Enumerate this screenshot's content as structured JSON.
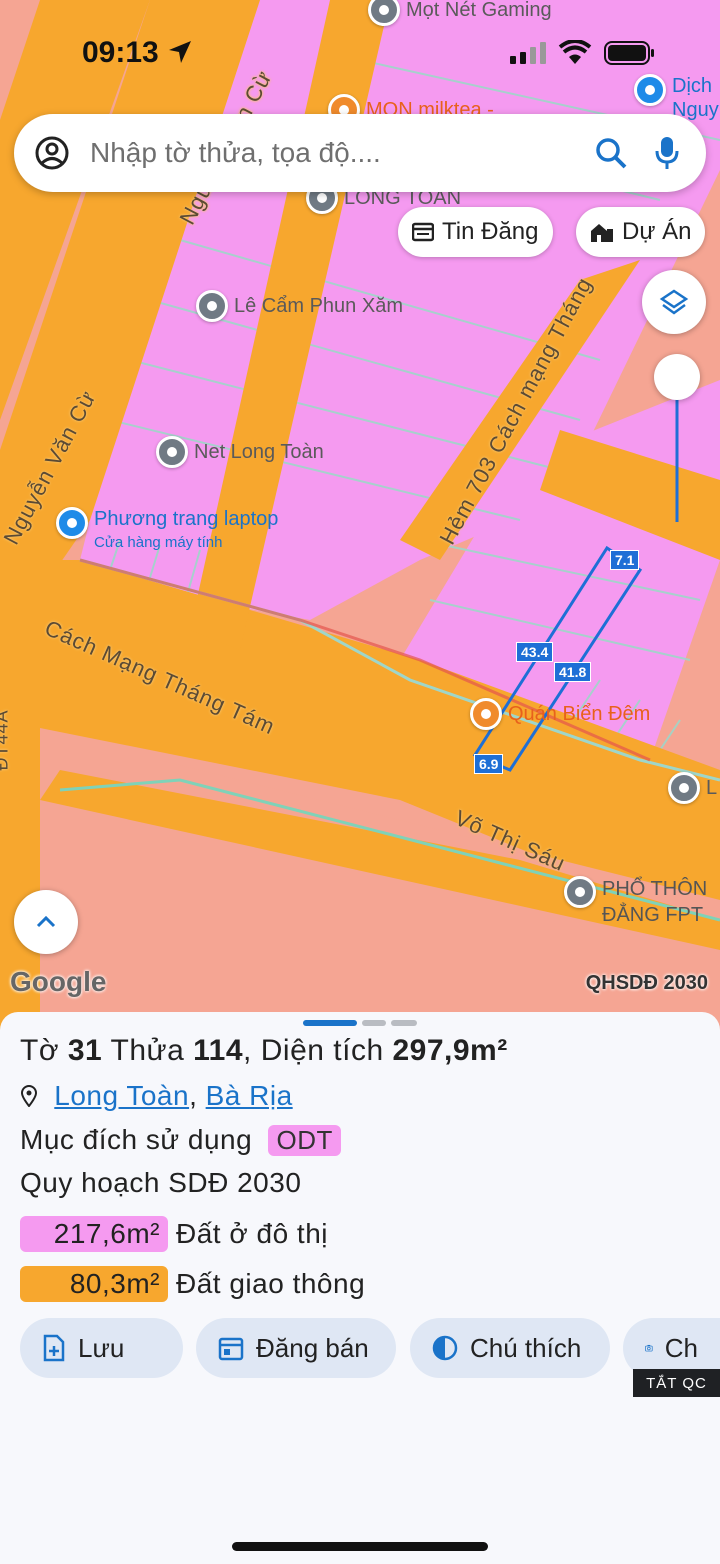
{
  "status_bar": {
    "time": "09:13"
  },
  "search": {
    "placeholder": "Nhập tờ thửa, tọa độ...."
  },
  "chips": {
    "tin_dang": "Tin Đăng",
    "du_an": "Dự Án"
  },
  "map": {
    "pois": [
      {
        "name": "Mọt Nét Gaming"
      },
      {
        "name": "MON milktea -"
      },
      {
        "name": "Dịch"
      },
      {
        "name": "Nguy"
      },
      {
        "name": "LONG TOÀN"
      },
      {
        "name": "Lê Cẩm Phun Xăm"
      },
      {
        "name": "Net Long Toàn"
      },
      {
        "name": "Phương trang laptop",
        "subtitle": "Cửa hàng máy tính"
      },
      {
        "name": "Quán Biển Đêm"
      },
      {
        "name": "PHỔ THÔN"
      },
      {
        "name": "ĐẲNG FPT"
      },
      {
        "name": "L"
      }
    ],
    "roads": [
      "Nguyễn Văn Cừ",
      "Nguyễn Văn Cừ",
      "Hẻm 703 Cách mạng Tháng",
      "Cách Mạng Tháng Tám",
      "Võ Thị Sáu",
      "ĐT44A"
    ],
    "dimensions": [
      "7.1",
      "43.4",
      "41.8",
      "6.9"
    ],
    "attribution": "Google",
    "layer_name": "QHSDĐ 2030",
    "colors": {
      "residential": "#f59af0",
      "road": "#f7a72e",
      "other": "#f5a593",
      "outline": "#1e6fd6"
    }
  },
  "parcel": {
    "title_prefix": "Tờ",
    "sheet_no": "31",
    "parcel_label": "Thửa",
    "parcel_no": "114",
    "area_label": "Diện tích",
    "area": "297,9m²",
    "ward": "Long Toàn",
    "city": "Bà Rịa",
    "purpose_label": "Mục đích sử dụng",
    "purpose_code": "ODT",
    "plan_label": "Quy hoạch SDĐ 2030",
    "plan_items": [
      {
        "area": "217,6m²",
        "label": "Đất ở đô thị",
        "color": "#f59af0"
      },
      {
        "area": "80,3m²",
        "label": "Đất giao thông",
        "color": "#f7a72e"
      }
    ]
  },
  "actions": [
    {
      "label": "Lưu",
      "icon": "file-plus-icon"
    },
    {
      "label": "Đăng bán",
      "icon": "calendar-icon"
    },
    {
      "label": "Chú thích",
      "icon": "contrast-icon"
    },
    {
      "label": "Ch",
      "icon": "camera-icon"
    }
  ],
  "ad_badge": "TẮT QC"
}
